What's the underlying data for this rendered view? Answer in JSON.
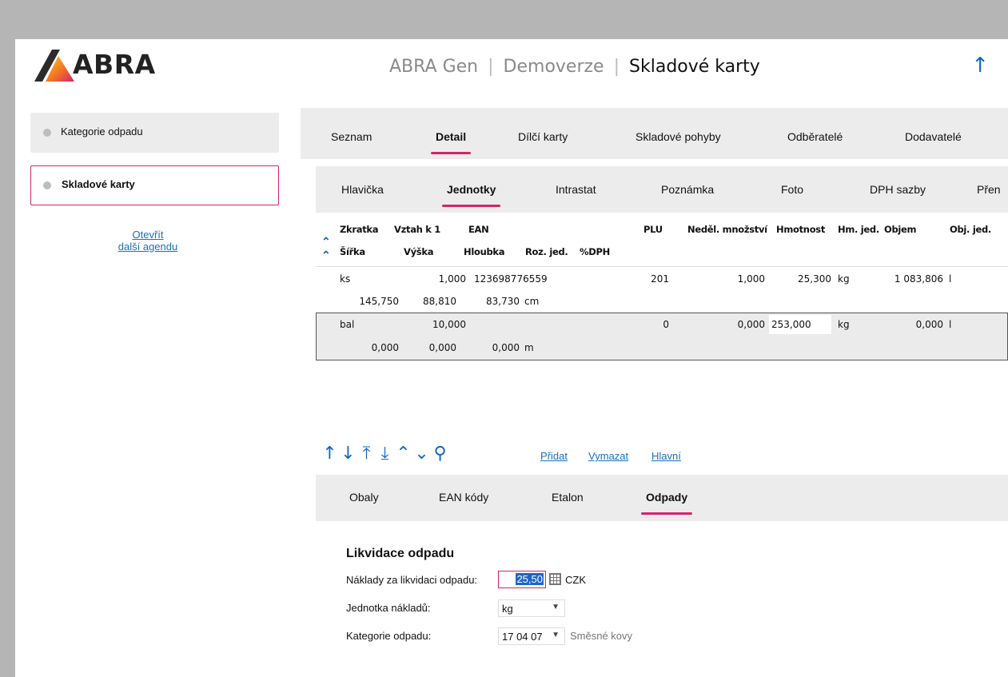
{
  "app": {
    "logo_text": "ABRA",
    "product": "ABRA Gen",
    "mode": "Demoverze",
    "agenda": "Skladové karty",
    "up_icon": "arrow-up-icon",
    "accent": "#d4246a",
    "link_color": "#1a6fc2"
  },
  "sidebar": {
    "items": [
      {
        "label": "Kategorie odpadu",
        "active": false
      },
      {
        "label": "Skladové karty",
        "active": true
      }
    ],
    "open_more_line1": "Otevřít",
    "open_more_line2": "další agendu"
  },
  "main_tabs": [
    "Seznam",
    "Detail",
    "Dílčí karty",
    "Skladové pohyby",
    "Odběratelé",
    "Dodavatelé"
  ],
  "main_tab_active": "Detail",
  "detail_tabs": [
    "Hlavička",
    "Jednotky",
    "Intrastat",
    "Poznámka",
    "Foto",
    "DPH sazby",
    "Přen"
  ],
  "detail_tab_active": "Jednotky",
  "grid": {
    "header_row1": [
      "Zkratka",
      "Vztah k 1",
      "EAN",
      "PLU",
      "Neděl. množství",
      "Hmotnost",
      "Hm. jed.",
      "Objem",
      "Obj. jed."
    ],
    "header_row2": [
      "Šířka",
      "Výška",
      "Hloubka",
      "Roz. jed.",
      "%DPH"
    ],
    "rows": [
      {
        "zkratka": "ks",
        "vztah": "1,000",
        "ean": "123698776559",
        "plu": "201",
        "nedel": "1,000",
        "hmotnost": "25,300",
        "hm_jed": "kg",
        "objem": "1 083,806",
        "obj_jed": "l",
        "sirka": "145,750",
        "vyska": "88,810",
        "hloubka": "83,730",
        "roz_jed": "cm"
      },
      {
        "zkratka": "bal",
        "vztah": "10,000",
        "ean": "",
        "plu": "0",
        "nedel": "0,000",
        "hmotnost": "253,000",
        "hm_jed": "kg",
        "objem": "0,000",
        "obj_jed": "l",
        "sirka": "0,000",
        "vyska": "0,000",
        "hloubka": "0,000",
        "roz_jed": "m"
      }
    ],
    "actions": [
      "Přidat",
      "Vymazat",
      "Hlavní"
    ]
  },
  "sub_tabs": [
    "Obaly",
    "EAN kódy",
    "Etalon",
    "Odpady"
  ],
  "sub_tab_active": "Odpady",
  "form": {
    "title": "Likvidace odpadu",
    "cost_label": "Náklady za likvidaci odpadu:",
    "cost_value": "25,50",
    "currency": "CZK",
    "unit_label": "Jednotka nákladů:",
    "unit_value": "kg",
    "category_label": "Kategorie odpadu:",
    "category_code": "17 04 07",
    "category_name": "Směsné kovy"
  }
}
